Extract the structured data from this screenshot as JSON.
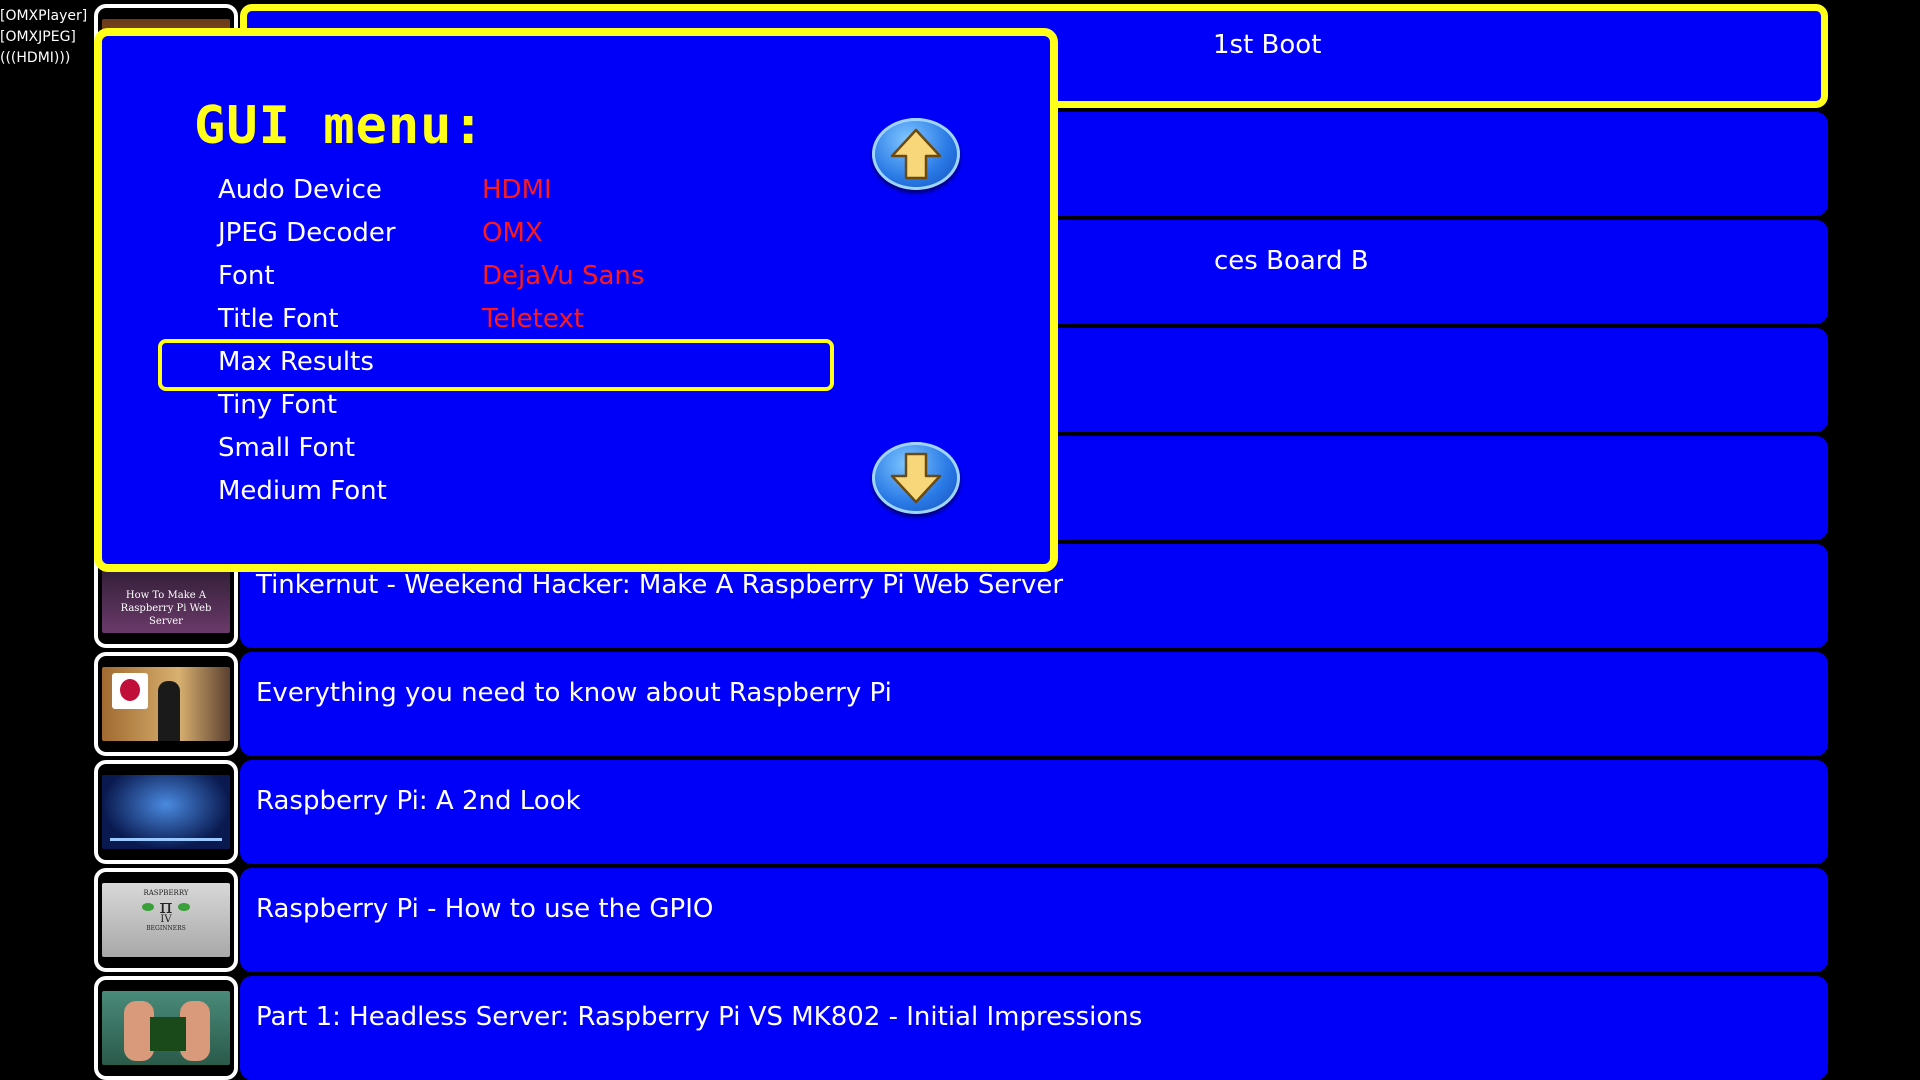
{
  "status": {
    "lines": [
      "[OMXPlayer]",
      "[OMXJPEG]",
      "(((HDMI)))"
    ]
  },
  "results": [
    {
      "title": "1st Boot",
      "selected": true,
      "thumb": "video-thumb-1"
    },
    {
      "title": "",
      "thumb": "video-thumb-2"
    },
    {
      "title": "ces Board B",
      "thumb": "video-thumb-3"
    },
    {
      "title": "",
      "thumb": "video-thumb-4"
    },
    {
      "title": "",
      "thumb": "video-thumb-5"
    },
    {
      "title": "Tinkernut - Weekend Hacker: Make A Raspberry Pi Web Server",
      "thumb": "video-thumb-6",
      "thumb_text": [
        "How To Make A",
        "Raspberry Pi Web Server"
      ]
    },
    {
      "title": "Everything you need to know about Raspberry Pi",
      "thumb": "video-thumb-7"
    },
    {
      "title": "Raspberry Pi: A 2nd Look",
      "thumb": "video-thumb-8"
    },
    {
      "title": "Raspberry Pi - How to use the GPIO",
      "thumb": "video-thumb-9",
      "thumb_text": [
        "RASPBERRY",
        "π",
        "IV",
        "BEGINNERS"
      ]
    },
    {
      "title": "Part 1: Headless Server: Raspberry Pi VS MK802 - Initial Impressions",
      "thumb": "video-thumb-10"
    }
  ],
  "dialog": {
    "title": "GUI menu:",
    "items": [
      {
        "label": "Audo Device",
        "value": "HDMI"
      },
      {
        "label": "JPEG Decoder",
        "value": "OMX"
      },
      {
        "label": "Font",
        "value": "DejaVu Sans"
      },
      {
        "label": "Title Font",
        "value": "Teletext"
      },
      {
        "label": "Max Results",
        "value": "",
        "highlighted": true
      },
      {
        "label": "Tiny Font",
        "value": ""
      },
      {
        "label": "Small Font",
        "value": ""
      },
      {
        "label": "Medium Font",
        "value": ""
      }
    ],
    "up_icon": "arrow-up-icon",
    "down_icon": "arrow-down-icon"
  },
  "colors": {
    "panel": "#0000fa",
    "highlight": "#ffff1a",
    "value": "#ff1a1a",
    "text": "#ffffff"
  }
}
